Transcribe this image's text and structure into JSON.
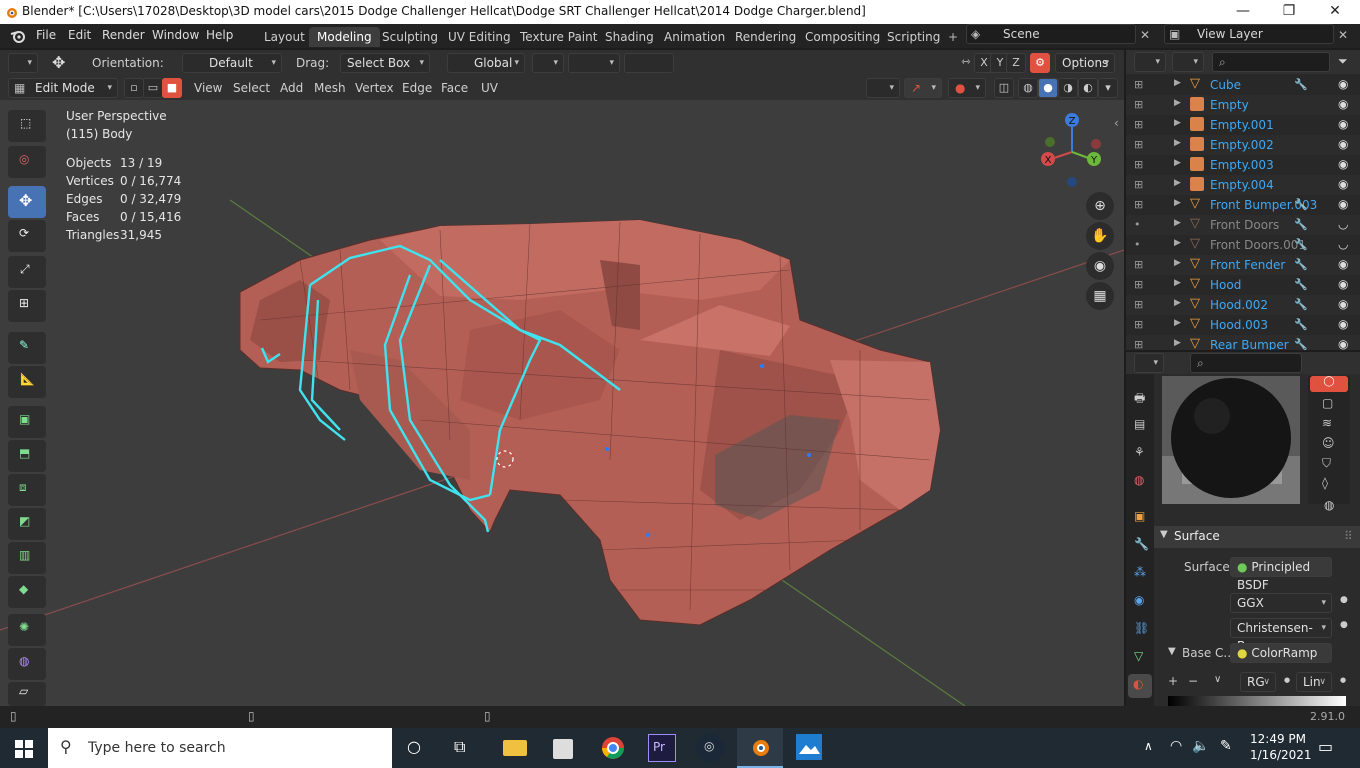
{
  "titlebar": {
    "title": "Blender* [C:\\Users\\17028\\Desktop\\3D model cars\\2015 Dodge Challenger Hellcat\\Dodge SRT Challenger Hellcat\\2014 Dodge Charger.blend]",
    "minimize": "—",
    "maximize": "❐",
    "close": "✕"
  },
  "menu": [
    "File",
    "Edit",
    "Render",
    "Window",
    "Help"
  ],
  "workspaces": [
    "Layout",
    "Modeling",
    "Sculpting",
    "UV Editing",
    "Texture Paint",
    "Shading",
    "Animation",
    "Rendering",
    "Compositing",
    "Scripting"
  ],
  "active_workspace": "Modeling",
  "scene": {
    "label": "Scene",
    "view_layer": "View Layer"
  },
  "header1": {
    "orientation_label": "Orientation:",
    "orientation_value": "Default",
    "drag_label": "Drag:",
    "drag_value": "Select Box",
    "transform_value": "Global",
    "axes": [
      "X",
      "Y",
      "Z"
    ],
    "options": "Options"
  },
  "header2": {
    "mode": "Edit Mode",
    "menus": [
      "View",
      "Select",
      "Add",
      "Mesh",
      "Vertex",
      "Edge",
      "Face",
      "UV"
    ]
  },
  "viewport": {
    "perspective": "User Perspective",
    "object": "(115) Body",
    "stats": [
      {
        "label": "Objects",
        "value": "13 / 19"
      },
      {
        "label": "Vertices",
        "value": "0 / 16,774"
      },
      {
        "label": "Edges",
        "value": "0 / 32,479"
      },
      {
        "label": "Faces",
        "value": "0 / 15,416"
      },
      {
        "label": "Triangles",
        "value": "31,945"
      }
    ],
    "gizmo": {
      "x": "X",
      "y": "Y",
      "z": "Z"
    }
  },
  "outliner": {
    "items": [
      {
        "name": "Cube",
        "type": "mesh",
        "dim": false
      },
      {
        "name": "Empty",
        "type": "empty",
        "dim": false
      },
      {
        "name": "Empty.001",
        "type": "empty",
        "dim": false
      },
      {
        "name": "Empty.002",
        "type": "empty",
        "dim": false
      },
      {
        "name": "Empty.003",
        "type": "empty",
        "dim": false
      },
      {
        "name": "Empty.004",
        "type": "empty",
        "dim": false
      },
      {
        "name": "Front Bumper.003",
        "type": "mesh",
        "dim": false
      },
      {
        "name": "Front Doors",
        "type": "mesh",
        "dim": true
      },
      {
        "name": "Front Doors.001",
        "type": "mesh",
        "dim": true
      },
      {
        "name": "Front Fender",
        "type": "mesh",
        "dim": false
      },
      {
        "name": "Hood",
        "type": "mesh",
        "dim": false
      },
      {
        "name": "Hood.002",
        "type": "mesh",
        "dim": false
      },
      {
        "name": "Hood.003",
        "type": "mesh",
        "dim": false
      },
      {
        "name": "Rear Bumper",
        "type": "mesh",
        "dim": false
      }
    ]
  },
  "properties": {
    "section": "Surface",
    "surface_label": "Surface",
    "surface_value": "Principled BSDF",
    "distribution": "GGX",
    "subsurface": "Christensen-Bu...",
    "base_color_label": "Base C...",
    "base_color_value": "ColorRamp",
    "ramp_mode": "RG",
    "ramp_interp": "Lin"
  },
  "statusbar": {
    "version": "2.91.0"
  },
  "taskbar": {
    "search_placeholder": "Type here to search",
    "time": "12:49 PM",
    "date": "1/16/2021"
  },
  "colors": {
    "accent": "#4772b3",
    "mesh": "#b45f55",
    "selection": "#3fe3ef",
    "outliner_text": "#3fa8f5"
  }
}
